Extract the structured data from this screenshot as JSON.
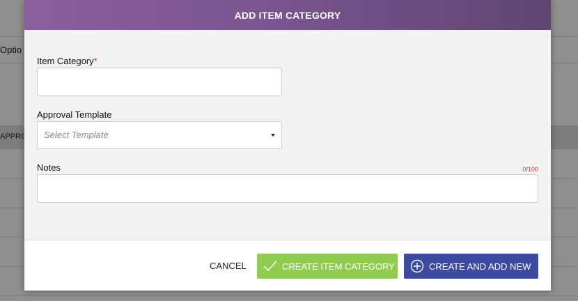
{
  "background": {
    "options_fragment": "Optio",
    "approval_fragment": "APPROV"
  },
  "modal": {
    "title": "ADD ITEM CATEGORY",
    "item_category": {
      "label": "Item Category",
      "required_mark": "*",
      "value": ""
    },
    "approval_template": {
      "label": "Approval Template",
      "placeholder": "Select Template"
    },
    "notes": {
      "label": "Notes",
      "count_current": "0",
      "count_separator": "/",
      "count_max": "100",
      "value": ""
    },
    "footer": {
      "cancel_label": "CANCEL",
      "create_label": "CREATE ITEM CATEGORY",
      "create_new_label": "CREATE AND ADD NEW"
    }
  },
  "icons": {
    "create": "checkmark-icon",
    "create_new": "plus-circle-icon"
  },
  "colors": {
    "header_start": "#8a5f9c",
    "header_end": "#5f4571",
    "create_button": "#8fcc4f",
    "create_new_button": "#3c4aa0",
    "required": "#c0392b",
    "counter_current": "#2aa52a"
  }
}
